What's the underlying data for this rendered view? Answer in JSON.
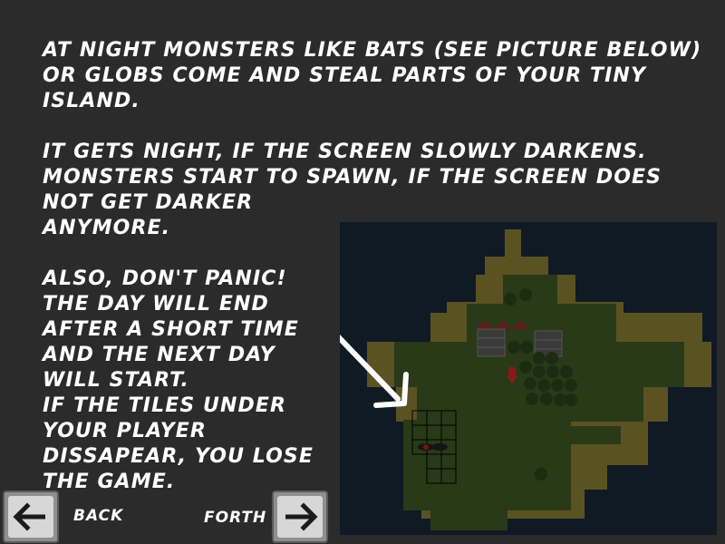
{
  "tutorial": {
    "paragraph1": "AT NIGHT MONSTERS LIKE BATS (SEE PICTURE BELOW)\nOR GLOBS COME AND STEAL PARTS OF YOUR TINY\nISLAND.",
    "paragraph2": "IT GETS NIGHT, IF THE SCREEN SLOWLY DARKENS.\nMONSTERS START TO SPAWN, IF THE SCREEN DOES\nNOT GET DARKER\nANYMORE.",
    "paragraph3": "ALSO, DON'T PANIC!\nTHE DAY WILL END\nAFTER A SHORT TIME\nAND THE NEXT DAY\nWILL START.\nIF THE TILES UNDER\nYOUR PLAYER\nDISSAPEAR, YOU LOSE\nTHE GAME."
  },
  "navigation": {
    "back_label": "BACK",
    "forth_label": "FORTH",
    "back_icon": "arrow-left-icon",
    "forth_icon": "arrow-right-icon"
  },
  "screenshot": {
    "pointer_icon": "arrow-pointer-icon",
    "colors": {
      "water": "#0f1a24",
      "sand": "#5b5222",
      "grass": "#283a17",
      "tree": "#1c2c11"
    }
  }
}
